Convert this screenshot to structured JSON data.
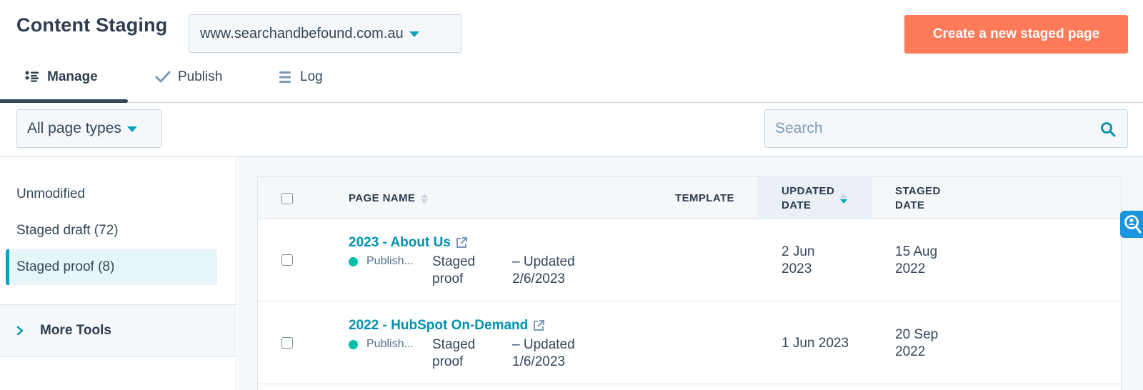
{
  "header": {
    "title": "Content Staging",
    "domain_select": "www.searchandbefound.com.au",
    "create_button": "Create a new staged page"
  },
  "tabs": [
    {
      "label": "Manage",
      "icon": "list-bullets-icon",
      "active": true
    },
    {
      "label": "Publish",
      "icon": "checkmark-icon",
      "active": false
    },
    {
      "label": "Log",
      "icon": "menu-lines-icon",
      "active": false
    }
  ],
  "filters": {
    "page_type": "All page types",
    "search_placeholder": "Search",
    "search_value": ""
  },
  "sidebar": {
    "items": [
      {
        "label": "Unmodified",
        "active": false
      },
      {
        "label": "Staged draft (72)",
        "active": false
      },
      {
        "label": "Staged proof (8)",
        "active": true
      }
    ],
    "more_tools": "More Tools"
  },
  "table": {
    "columns": {
      "page_name": "PAGE NAME",
      "template": "TEMPLATE",
      "updated_line1": "UPDATED",
      "updated_line2": "DATE",
      "staged_line1": "STAGED",
      "staged_line2": "DATE"
    },
    "sort": {
      "column": "UPDATED DATE",
      "direction": "descending"
    },
    "rows": [
      {
        "name": "2023 - About Us",
        "status": "Publish...",
        "staged_l1": "Staged",
        "staged_l2": "proof",
        "updated_l1": "– Updated",
        "updated_l2": "2/6/2023",
        "template": "",
        "updated_date_l1": "2 Jun",
        "updated_date_l2": "2023",
        "staged_date_l1": "15 Aug",
        "staged_date_l2": "2022"
      },
      {
        "name": "2022 - HubSpot On-Demand",
        "status": "Publish...",
        "staged_l1": "Staged",
        "staged_l2": "proof",
        "updated_l1": "– Updated",
        "updated_l2": "1/6/2023",
        "template": "",
        "updated_date_l1": "1 Jun 2023",
        "updated_date_l2": "",
        "staged_date_l1": "20 Sep",
        "staged_date_l2": "2022"
      }
    ]
  },
  "colors": {
    "accent": "#00a4bd",
    "link": "#0091ae",
    "primary_button": "#ff7a59",
    "status_published": "#00bda5",
    "assistant_button": "#1b95e0"
  }
}
